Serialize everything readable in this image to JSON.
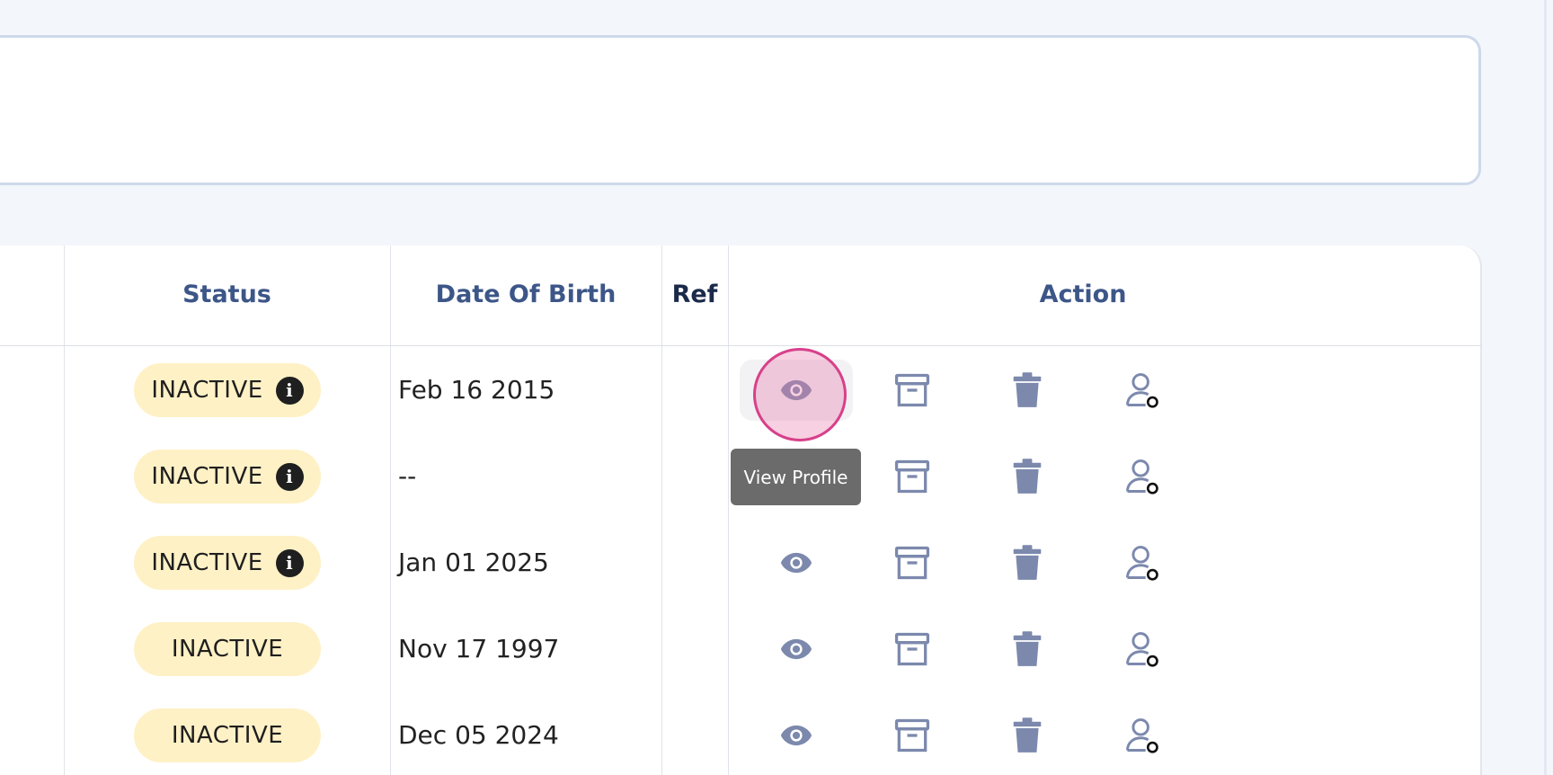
{
  "table": {
    "headers": {
      "status": "Status",
      "dob": "Date Of Birth",
      "ref": "Ref",
      "action": "Action"
    },
    "rows": [
      {
        "status": "INACTIVE",
        "has_info": true,
        "dob": "Feb 16 2015"
      },
      {
        "status": "INACTIVE",
        "has_info": true,
        "dob": "--"
      },
      {
        "status": "INACTIVE",
        "has_info": true,
        "dob": "Jan 01 2025"
      },
      {
        "status": "INACTIVE",
        "has_info": false,
        "dob": "Nov 17 1997"
      },
      {
        "status": "INACTIVE",
        "has_info": false,
        "dob": "Dec 05 2024"
      }
    ],
    "info_glyph": "i"
  },
  "actions": {
    "icons": [
      "eye-icon",
      "archive-icon",
      "trash-icon",
      "user-status-icon"
    ],
    "tooltip": "View Profile"
  },
  "colors": {
    "page_bg": "#f3f6fb",
    "header_text": "#3d5688",
    "pill_bg": "#fff1c6",
    "icon": "#7c89ad",
    "click_ring": "#d8408a",
    "tooltip_bg": "#6b6b6b"
  }
}
